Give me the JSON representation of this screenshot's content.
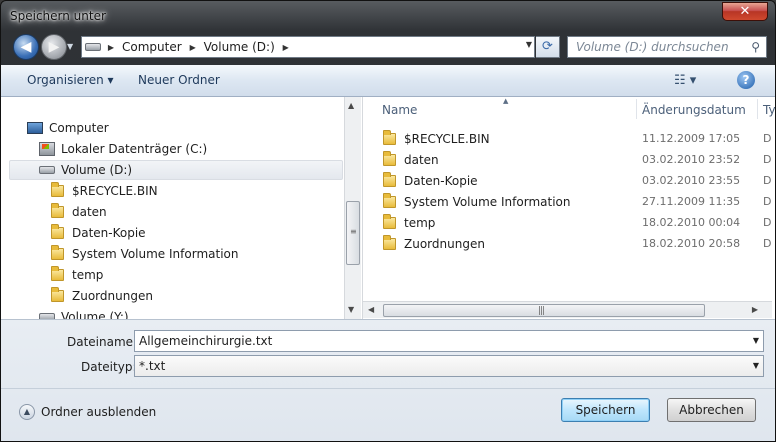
{
  "window": {
    "title": "Speichern unter",
    "close_label": "✕"
  },
  "nav": {
    "back_glyph": "◀",
    "forward_glyph": "▶",
    "address": {
      "segments": [
        "Computer",
        "Volume (D:)"
      ]
    },
    "search_placeholder": "Volume (D:) durchsuchen"
  },
  "toolbar": {
    "organize_label": "Organisieren ▾",
    "new_folder_label": "Neuer Ordner",
    "view_label": "☷ ▾",
    "help_label": "?"
  },
  "tree": {
    "items": [
      {
        "label": "Computer",
        "icon": "computer-icon"
      },
      {
        "label": "Lokaler Datenträger (C:)",
        "icon": "drive-c-icon"
      },
      {
        "label": "Volume (D:)",
        "icon": "drive-icon"
      },
      {
        "label": "$RECYCLE.BIN",
        "icon": "folder-icon"
      },
      {
        "label": "daten",
        "icon": "folder-icon"
      },
      {
        "label": "Daten-Kopie",
        "icon": "folder-icon"
      },
      {
        "label": "System Volume Information",
        "icon": "folder-icon"
      },
      {
        "label": "temp",
        "icon": "folder-icon"
      },
      {
        "label": "Zuordnungen",
        "icon": "folder-icon"
      },
      {
        "label": "Volume (Y:)",
        "icon": "drive-icon"
      }
    ]
  },
  "files": {
    "columns": [
      "Name",
      "Änderungsdatum",
      "Typ"
    ],
    "rows": [
      {
        "name": "$RECYCLE.BIN",
        "date": "11.12.2009 17:05",
        "type": "D"
      },
      {
        "name": "daten",
        "date": "03.02.2010 23:52",
        "type": "D"
      },
      {
        "name": "Daten-Kopie",
        "date": "03.02.2010 23:55",
        "type": "D"
      },
      {
        "name": "System Volume Information",
        "date": "27.11.2009 11:35",
        "type": "D"
      },
      {
        "name": "temp",
        "date": "18.02.2010 00:04",
        "type": "D"
      },
      {
        "name": "Zuordnungen",
        "date": "18.02.2010 20:58",
        "type": "D"
      }
    ]
  },
  "form": {
    "filename_label": "Dateiname:",
    "filename_value": "Allgemeinchirurgie.txt",
    "filetype_label": "Dateityp:",
    "filetype_value": "*.txt"
  },
  "footer": {
    "hide_folders_label": "Ordner ausblenden",
    "save_label": "Speichern",
    "cancel_label": "Abbrechen"
  }
}
